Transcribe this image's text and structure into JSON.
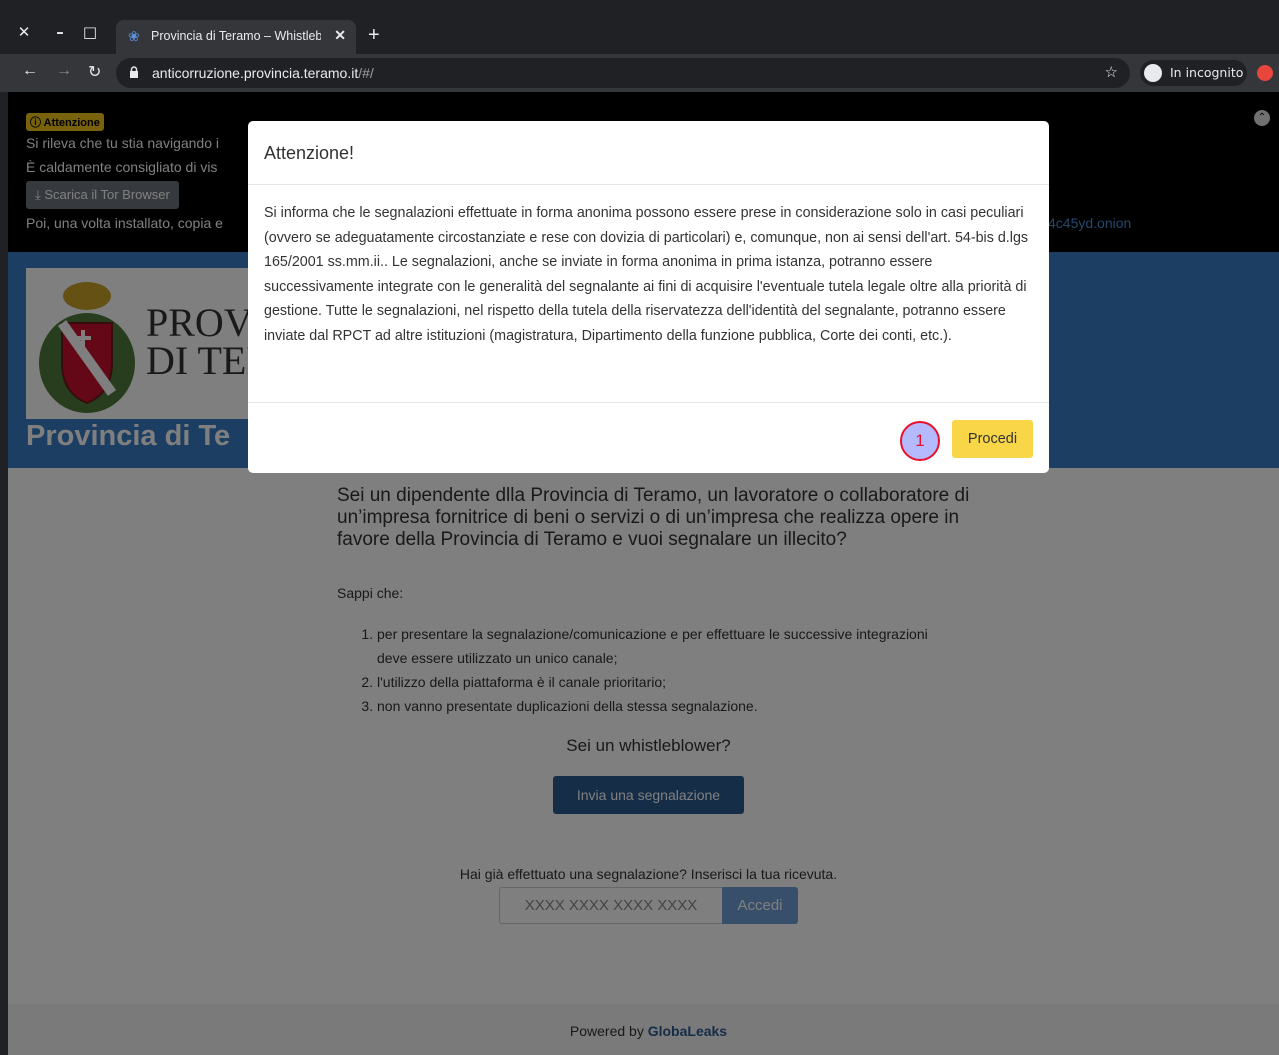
{
  "browser": {
    "tab_title": "Provincia di Teramo – Whistleblowing",
    "tab_close": "✕",
    "new_tab": "+",
    "url_host": "anticorruzione.provincia.teramo.it",
    "url_path": "/#/",
    "incognito_label": "In incognito"
  },
  "warning": {
    "badge": "ⓘ Attenzione",
    "line1": "Si rileva che tu stia navigando i",
    "line2": "È caldamente consigliato di vis",
    "tor_button": "⤓ Scarica il Tor Browser",
    "line3": "Poi, una volta installato, copia e",
    "onion_tail": "4c45yd.onion"
  },
  "header": {
    "logo_text_1": "PROVI",
    "logo_text_2": "DI TER",
    "title": "Provincia di Te"
  },
  "content": {
    "question": "Sei un dipendente dlla Provincia di Teramo, un lavoratore o collaboratore di un’impresa fornitrice di beni o servizi o di un’impresa che realizza opere in favore della Provincia di Teramo e vuoi segnalare un illecito?",
    "sappi": "Sappi che:",
    "rules": [
      "per presentare la segnalazione/comunicazione e per effettuare le successive integrazioni deve essere utilizzato un unico canale;",
      "l'utilizzo della piattaforma è il canale prioritario;",
      "non vanno presentate duplicazioni della stessa segnalazione."
    ],
    "whistleblower_q": "Sei un whistleblower?",
    "submit_button": "Invia una segnalazione",
    "receipt_prompt": "Hai già effettuato una segnalazione? Inserisci la tua ricevuta.",
    "receipt_placeholder": "XXXX XXXX XXXX XXXX",
    "login_button": "Accedi"
  },
  "footer": {
    "powered_by": "Powered by",
    "brand": "GlobaLeaks"
  },
  "modal": {
    "title": "Attenzione!",
    "body": "Si informa che le segnalazioni effettuate in forma anonima possono essere prese in considerazione solo in casi peculiari (ovvero se adeguatamente circostanziate e rese con dovizia di particolari) e, comunque, non ai sensi dell'art. 54-bis d.lgs 165/2001 ss.mm.ii.. Le segnalazioni, anche se inviate in forma anonima in prima istanza, potranno essere successivamente integrate con le generalità del segnalante ai fini di acquisire l'eventuale tutela legale oltre alla priorità di gestione. Tutte le segnalazioni, nel rispetto della tutela della riservatezza dell'identità del segnalante, potranno essere inviate dal RPCT ad altre istituzioni (magistratura, Dipartimento della funzione pubblica, Corte dei conti, etc.).",
    "proceed_button": "Procedi",
    "marker": "1"
  },
  "colors": {
    "brand_blue": "#3a7dc6",
    "proceed_yellow": "#f9d648",
    "submit_blue": "#2c5a8f"
  }
}
